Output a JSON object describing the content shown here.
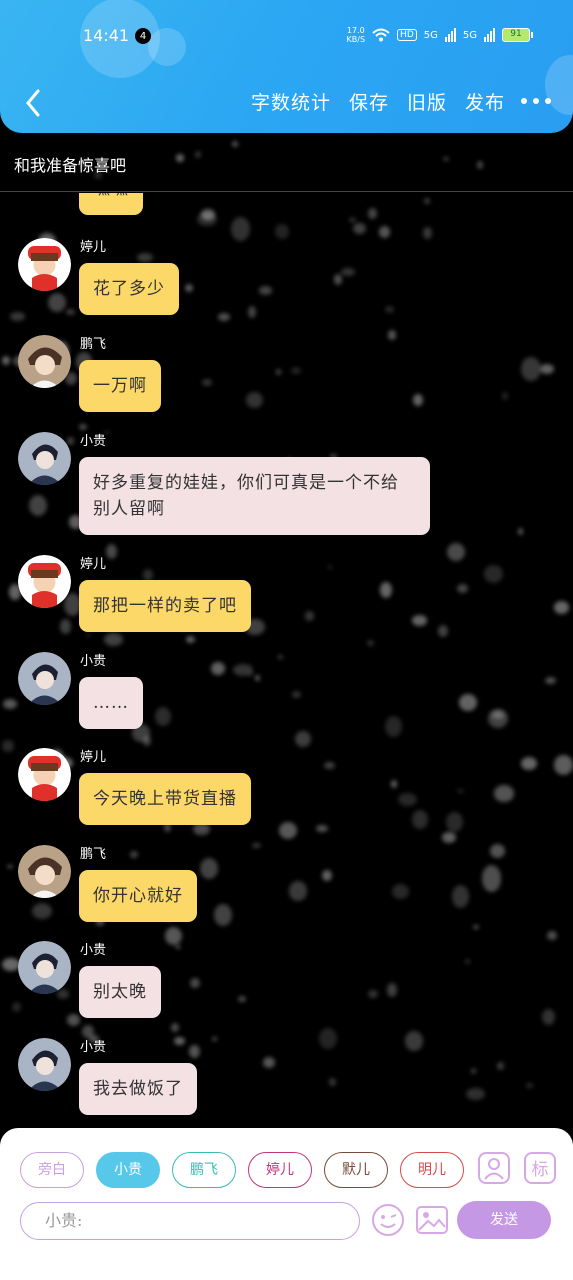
{
  "status_bar": {
    "time": "14:41",
    "notification_count": "4",
    "net_speed_value": "17.0",
    "net_speed_unit": "KB/S",
    "hd": "HD",
    "signal_1": "5G",
    "signal_2": "5G",
    "battery": "91"
  },
  "toolbar": {
    "actions": [
      "字数统计",
      "保存",
      "旧版",
      "发布"
    ]
  },
  "title": "和我准备惊喜吧",
  "messages": [
    {
      "speaker": "",
      "text": "嘿嘿",
      "color": "yellow"
    },
    {
      "speaker": "婷儿",
      "text": "花了多少",
      "color": "yellow"
    },
    {
      "speaker": "鹏飞",
      "text": "一万啊",
      "color": "yellow"
    },
    {
      "speaker": "小贵",
      "text": "好多重复的娃娃，你们可真是一个不给别人留啊",
      "color": "pink"
    },
    {
      "speaker": "婷儿",
      "text": "那把一样的卖了吧",
      "color": "yellow"
    },
    {
      "speaker": "小贵",
      "text": "……",
      "color": "pink"
    },
    {
      "speaker": "婷儿",
      "text": "今天晚上带货直播",
      "color": "yellow"
    },
    {
      "speaker": "鹏飞",
      "text": "你开心就好",
      "color": "yellow"
    },
    {
      "speaker": "小贵",
      "text": "别太晚",
      "color": "pink"
    },
    {
      "speaker": "小贵",
      "text": "我去做饭了",
      "color": "pink"
    }
  ],
  "characters": [
    {
      "label": "旁白",
      "color": "#c9a0e0",
      "selected": false
    },
    {
      "label": "小贵",
      "color": "#56c8ea",
      "selected": true
    },
    {
      "label": "鹏飞",
      "color": "#36bdb5",
      "selected": false
    },
    {
      "label": "婷儿",
      "color": "#c2357a",
      "selected": false
    },
    {
      "label": "默儿",
      "color": "#7a4a3a",
      "selected": false
    },
    {
      "label": "明儿",
      "color": "#d54a4a",
      "selected": false
    }
  ],
  "input": {
    "placeholder": "小贵:"
  },
  "send_label": "发送",
  "colors": {
    "header": "#2aa6f3",
    "bubble_yellow": "#fcd869",
    "bubble_pink": "#f3e1e4",
    "send": "#c598e6"
  }
}
